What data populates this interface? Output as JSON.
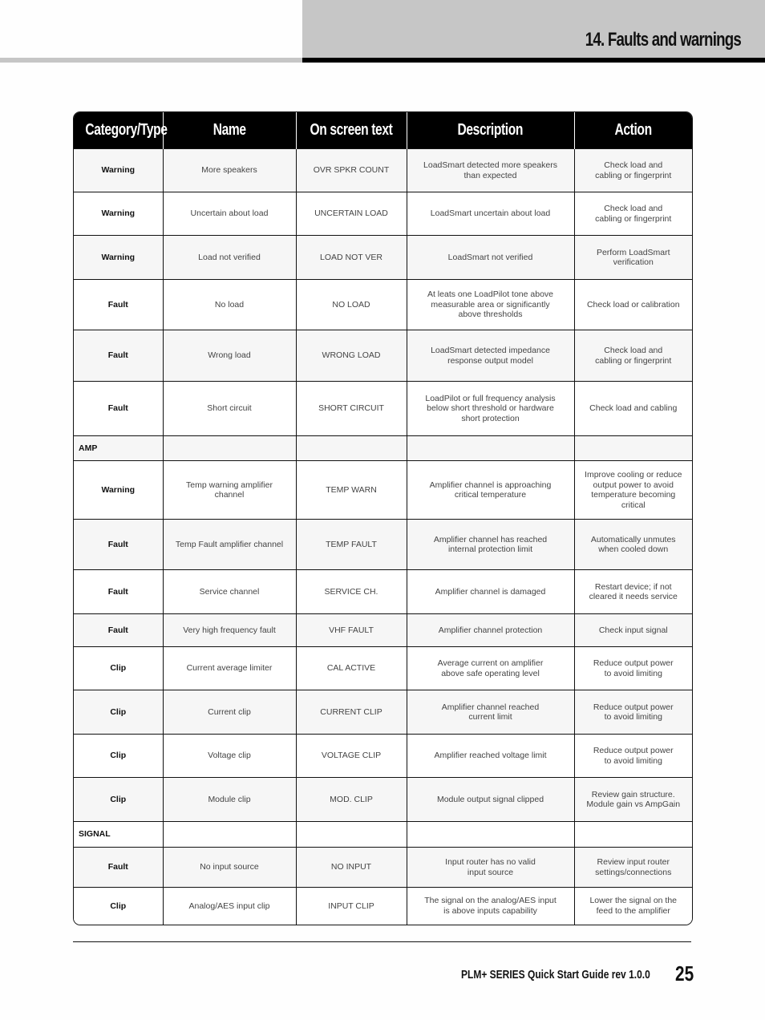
{
  "header": {
    "title": "14. Faults and warnings"
  },
  "table": {
    "columns": [
      "Category/Type",
      "Name",
      "On screen text",
      "Description",
      "Action"
    ],
    "rows": [
      {
        "type": "Warning",
        "name": "More speakers",
        "screen": "OVR SPKR COUNT",
        "desc": "LoadSmart detected more speakers\nthan expected",
        "action": "Check load and\ncabling or fingerprint"
      },
      {
        "type": "Warning",
        "name": "Uncertain about load",
        "screen": "UNCERTAIN LOAD",
        "desc": "LoadSmart uncertain about load",
        "action": "Check load and\ncabling or fingerprint"
      },
      {
        "type": "Warning",
        "name": "Load not verified",
        "screen": "LOAD NOT VER",
        "desc": "LoadSmart not verified",
        "action": "Perform LoadSmart\nverification"
      },
      {
        "type": "Fault",
        "name": "No load",
        "screen": "NO LOAD",
        "desc": "At leats one LoadPilot tone above\nmeasurable area or significantly\nabove thresholds",
        "action": "Check load or calibration"
      },
      {
        "type": "Fault",
        "name": "Wrong load",
        "screen": "WRONG LOAD",
        "desc": "LoadSmart detected impedance\nresponse output model",
        "action": "Check load and\ncabling or fingerprint"
      },
      {
        "type": "Fault",
        "name": "Short circuit",
        "screen": "SHORT CIRCUIT",
        "desc": "LoadPilot or full frequency analysis\nbelow short threshold or hardware\nshort protection",
        "action": "Check load and cabling"
      },
      {
        "section": "AMP"
      },
      {
        "type": "Warning",
        "name": "Temp warning amplifier\nchannel",
        "screen": "TEMP WARN",
        "desc": "Amplifier channel is approaching\ncritical temperature",
        "action": "Improve cooling or reduce\noutput power to avoid\ntemperature becoming\ncritical"
      },
      {
        "type": "Fault",
        "name": "Temp Fault amplifier channel",
        "screen": "TEMP FAULT",
        "desc": "Amplifier channel has reached\ninternal protection limit",
        "action": "Automatically unmutes\nwhen cooled down"
      },
      {
        "type": "Fault",
        "name": "Service channel",
        "screen": "SERVICE CH.",
        "desc": "Amplifier channel is damaged",
        "action": "Restart device; if not\ncleared it needs service"
      },
      {
        "type": "Fault",
        "name": "Very high frequency fault",
        "screen": "VHF FAULT",
        "desc": "Amplifier channel protection",
        "action": "Check input signal"
      },
      {
        "type": "Clip",
        "name": "Current average limiter",
        "screen": "CAL ACTIVE",
        "desc": "Average current on amplifier\nabove safe operating level",
        "action": "Reduce output power\nto avoid limiting"
      },
      {
        "type": "Clip",
        "name": "Current clip",
        "screen": "CURRENT CLIP",
        "desc": "Amplifier channel reached\ncurrent limit",
        "action": "Reduce output power\nto avoid limiting"
      },
      {
        "type": "Clip",
        "name": "Voltage clip",
        "screen": "VOLTAGE CLIP",
        "desc": "Amplifier reached voltage limit",
        "action": "Reduce output power\nto avoid limiting"
      },
      {
        "type": "Clip",
        "name": "Module clip",
        "screen": "MOD. CLIP",
        "desc": "Module output signal clipped",
        "action": "Review gain structure.\nModule gain vs AmpGain"
      },
      {
        "section": "SIGNAL"
      },
      {
        "type": "Fault",
        "name": "No input source",
        "screen": "NO INPUT",
        "desc": "Input router has no valid\ninput source",
        "action": "Review input router\nsettings/connections"
      },
      {
        "type": "Clip",
        "name": "Analog/AES input clip",
        "screen": "INPUT CLIP",
        "desc": "The signal on the analog/AES input\nis above inputs capability",
        "action": "Lower the signal on the\nfeed to the amplifier"
      }
    ]
  },
  "footer": {
    "guide": "PLM+ SERIES  Quick Start Guide  rev 1.0.0",
    "page_number": "25"
  }
}
